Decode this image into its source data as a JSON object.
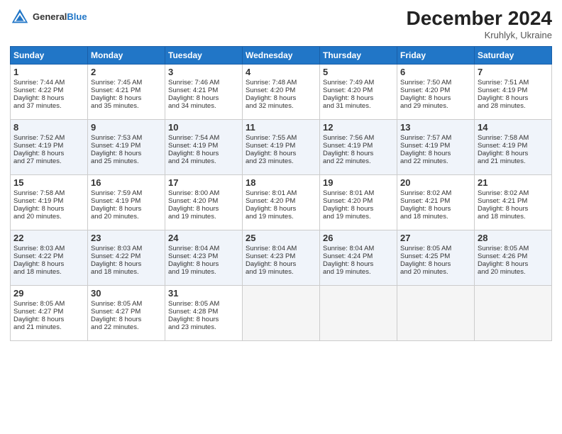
{
  "header": {
    "logo_general": "General",
    "logo_blue": "Blue",
    "month": "December 2024",
    "location": "Kruhlyk, Ukraine"
  },
  "weekdays": [
    "Sunday",
    "Monday",
    "Tuesday",
    "Wednesday",
    "Thursday",
    "Friday",
    "Saturday"
  ],
  "weeks": [
    [
      {
        "day": 1,
        "lines": [
          "Sunrise: 7:44 AM",
          "Sunset: 4:22 PM",
          "Daylight: 8 hours",
          "and 37 minutes."
        ]
      },
      {
        "day": 2,
        "lines": [
          "Sunrise: 7:45 AM",
          "Sunset: 4:21 PM",
          "Daylight: 8 hours",
          "and 35 minutes."
        ]
      },
      {
        "day": 3,
        "lines": [
          "Sunrise: 7:46 AM",
          "Sunset: 4:21 PM",
          "Daylight: 8 hours",
          "and 34 minutes."
        ]
      },
      {
        "day": 4,
        "lines": [
          "Sunrise: 7:48 AM",
          "Sunset: 4:20 PM",
          "Daylight: 8 hours",
          "and 32 minutes."
        ]
      },
      {
        "day": 5,
        "lines": [
          "Sunrise: 7:49 AM",
          "Sunset: 4:20 PM",
          "Daylight: 8 hours",
          "and 31 minutes."
        ]
      },
      {
        "day": 6,
        "lines": [
          "Sunrise: 7:50 AM",
          "Sunset: 4:20 PM",
          "Daylight: 8 hours",
          "and 29 minutes."
        ]
      },
      {
        "day": 7,
        "lines": [
          "Sunrise: 7:51 AM",
          "Sunset: 4:19 PM",
          "Daylight: 8 hours",
          "and 28 minutes."
        ]
      }
    ],
    [
      {
        "day": 8,
        "lines": [
          "Sunrise: 7:52 AM",
          "Sunset: 4:19 PM",
          "Daylight: 8 hours",
          "and 27 minutes."
        ]
      },
      {
        "day": 9,
        "lines": [
          "Sunrise: 7:53 AM",
          "Sunset: 4:19 PM",
          "Daylight: 8 hours",
          "and 25 minutes."
        ]
      },
      {
        "day": 10,
        "lines": [
          "Sunrise: 7:54 AM",
          "Sunset: 4:19 PM",
          "Daylight: 8 hours",
          "and 24 minutes."
        ]
      },
      {
        "day": 11,
        "lines": [
          "Sunrise: 7:55 AM",
          "Sunset: 4:19 PM",
          "Daylight: 8 hours",
          "and 23 minutes."
        ]
      },
      {
        "day": 12,
        "lines": [
          "Sunrise: 7:56 AM",
          "Sunset: 4:19 PM",
          "Daylight: 8 hours",
          "and 22 minutes."
        ]
      },
      {
        "day": 13,
        "lines": [
          "Sunrise: 7:57 AM",
          "Sunset: 4:19 PM",
          "Daylight: 8 hours",
          "and 22 minutes."
        ]
      },
      {
        "day": 14,
        "lines": [
          "Sunrise: 7:58 AM",
          "Sunset: 4:19 PM",
          "Daylight: 8 hours",
          "and 21 minutes."
        ]
      }
    ],
    [
      {
        "day": 15,
        "lines": [
          "Sunrise: 7:58 AM",
          "Sunset: 4:19 PM",
          "Daylight: 8 hours",
          "and 20 minutes."
        ]
      },
      {
        "day": 16,
        "lines": [
          "Sunrise: 7:59 AM",
          "Sunset: 4:19 PM",
          "Daylight: 8 hours",
          "and 20 minutes."
        ]
      },
      {
        "day": 17,
        "lines": [
          "Sunrise: 8:00 AM",
          "Sunset: 4:20 PM",
          "Daylight: 8 hours",
          "and 19 minutes."
        ]
      },
      {
        "day": 18,
        "lines": [
          "Sunrise: 8:01 AM",
          "Sunset: 4:20 PM",
          "Daylight: 8 hours",
          "and 19 minutes."
        ]
      },
      {
        "day": 19,
        "lines": [
          "Sunrise: 8:01 AM",
          "Sunset: 4:20 PM",
          "Daylight: 8 hours",
          "and 19 minutes."
        ]
      },
      {
        "day": 20,
        "lines": [
          "Sunrise: 8:02 AM",
          "Sunset: 4:21 PM",
          "Daylight: 8 hours",
          "and 18 minutes."
        ]
      },
      {
        "day": 21,
        "lines": [
          "Sunrise: 8:02 AM",
          "Sunset: 4:21 PM",
          "Daylight: 8 hours",
          "and 18 minutes."
        ]
      }
    ],
    [
      {
        "day": 22,
        "lines": [
          "Sunrise: 8:03 AM",
          "Sunset: 4:22 PM",
          "Daylight: 8 hours",
          "and 18 minutes."
        ]
      },
      {
        "day": 23,
        "lines": [
          "Sunrise: 8:03 AM",
          "Sunset: 4:22 PM",
          "Daylight: 8 hours",
          "and 18 minutes."
        ]
      },
      {
        "day": 24,
        "lines": [
          "Sunrise: 8:04 AM",
          "Sunset: 4:23 PM",
          "Daylight: 8 hours",
          "and 19 minutes."
        ]
      },
      {
        "day": 25,
        "lines": [
          "Sunrise: 8:04 AM",
          "Sunset: 4:23 PM",
          "Daylight: 8 hours",
          "and 19 minutes."
        ]
      },
      {
        "day": 26,
        "lines": [
          "Sunrise: 8:04 AM",
          "Sunset: 4:24 PM",
          "Daylight: 8 hours",
          "and 19 minutes."
        ]
      },
      {
        "day": 27,
        "lines": [
          "Sunrise: 8:05 AM",
          "Sunset: 4:25 PM",
          "Daylight: 8 hours",
          "and 20 minutes."
        ]
      },
      {
        "day": 28,
        "lines": [
          "Sunrise: 8:05 AM",
          "Sunset: 4:26 PM",
          "Daylight: 8 hours",
          "and 20 minutes."
        ]
      }
    ],
    [
      {
        "day": 29,
        "lines": [
          "Sunrise: 8:05 AM",
          "Sunset: 4:27 PM",
          "Daylight: 8 hours",
          "and 21 minutes."
        ]
      },
      {
        "day": 30,
        "lines": [
          "Sunrise: 8:05 AM",
          "Sunset: 4:27 PM",
          "Daylight: 8 hours",
          "and 22 minutes."
        ]
      },
      {
        "day": 31,
        "lines": [
          "Sunrise: 8:05 AM",
          "Sunset: 4:28 PM",
          "Daylight: 8 hours",
          "and 23 minutes."
        ]
      },
      null,
      null,
      null,
      null
    ]
  ]
}
